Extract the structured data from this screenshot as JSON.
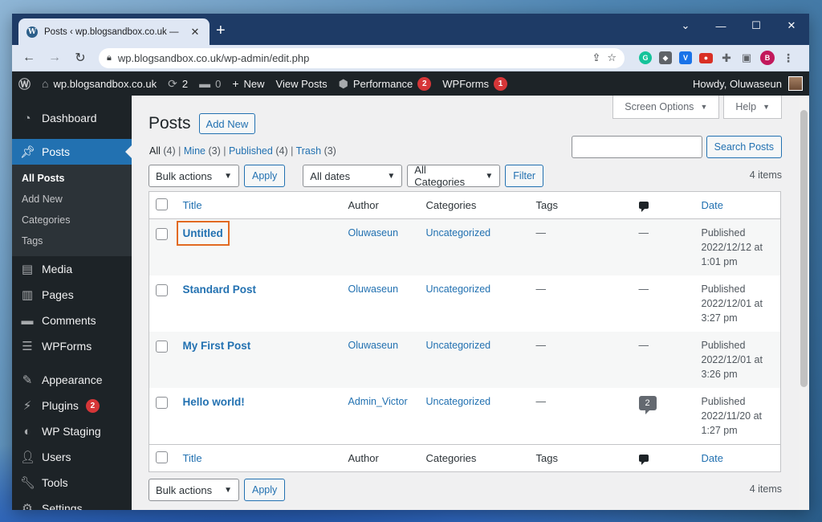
{
  "browser": {
    "tab_title": "Posts ‹ wp.blogsandbox.co.uk —",
    "tab_favicon": "W",
    "url": "wp.blogsandbox.co.uk/wp-admin/edit.php",
    "profile_initial": "B"
  },
  "adminbar": {
    "site_name": "wp.blogsandbox.co.uk",
    "updates_count": "2",
    "comments_count": "0",
    "new_label": "New",
    "view_posts": "View Posts",
    "performance_label": "Performance",
    "performance_count": "2",
    "wpforms_label": "WPForms",
    "wpforms_count": "1",
    "howdy": "Howdy, Oluwaseun"
  },
  "sidebar": {
    "dashboard": "Dashboard",
    "posts": "Posts",
    "sub": [
      "All Posts",
      "Add New",
      "Categories",
      "Tags"
    ],
    "media": "Media",
    "pages": "Pages",
    "comments": "Comments",
    "wpforms": "WPForms",
    "appearance": "Appearance",
    "plugins": "Plugins",
    "plugins_count": "2",
    "wpstaging": "WP Staging",
    "users": "Users",
    "tools": "Tools",
    "settings": "Settings"
  },
  "screen_meta": {
    "options": "Screen Options",
    "help": "Help"
  },
  "page": {
    "title": "Posts",
    "add_new": "Add New",
    "filters": {
      "all": "All",
      "all_count": "(4)",
      "mine": "Mine",
      "mine_count": "(3)",
      "published": "Published",
      "published_count": "(4)",
      "trash": "Trash",
      "trash_count": "(3)"
    },
    "search_button": "Search Posts",
    "bulk_actions": "Bulk actions",
    "apply": "Apply",
    "all_dates": "All dates",
    "all_categories": "All Categories",
    "filter": "Filter",
    "items_count": "4 items"
  },
  "table": {
    "columns": {
      "title": "Title",
      "author": "Author",
      "categories": "Categories",
      "tags": "Tags",
      "date": "Date"
    },
    "rows": [
      {
        "title": "Untitled",
        "author": "Oluwaseun",
        "category": "Uncategorized",
        "tags": "—",
        "comments": "—",
        "status": "Published",
        "date": "2022/12/12 at",
        "time": "1:01 pm"
      },
      {
        "title": "Standard Post",
        "author": "Oluwaseun",
        "category": "Uncategorized",
        "tags": "—",
        "comments": "—",
        "status": "Published",
        "date": "2022/12/01 at",
        "time": "3:27 pm"
      },
      {
        "title": "My First Post",
        "author": "Oluwaseun",
        "category": "Uncategorized",
        "tags": "—",
        "comments": "—",
        "status": "Published",
        "date": "2022/12/01 at",
        "time": "3:26 pm"
      },
      {
        "title": "Hello world!",
        "author": "Admin_Victor",
        "category": "Uncategorized",
        "tags": "—",
        "comments": "2",
        "status": "Published",
        "date": "2022/11/20 at",
        "time": "1:27 pm"
      }
    ]
  },
  "colors": {
    "wp_blue": "#2271b1",
    "admin_dark": "#1d2327",
    "highlight": "#e26a22"
  }
}
